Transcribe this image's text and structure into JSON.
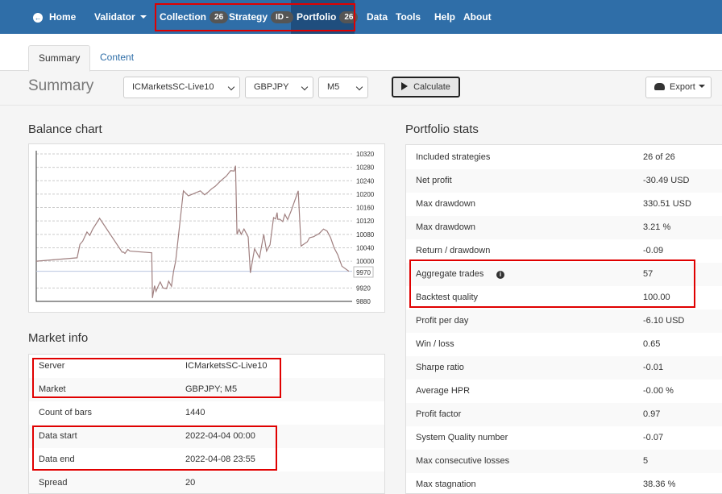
{
  "navbar": {
    "home": "Home",
    "validator": "Validator",
    "collection": "Collection",
    "collection_badge": "26",
    "strategy": "Strategy",
    "strategy_badge": "ID -",
    "portfolio": "Portfolio",
    "portfolio_badge": "26",
    "data": "Data",
    "tools": "Tools",
    "help": "Help",
    "about": "About"
  },
  "tabs": {
    "summary": "Summary",
    "content": "Content"
  },
  "toolbar": {
    "title": "Summary",
    "server": "ICMarketsSC-Live10",
    "symbol": "GBPJPY",
    "period": "M5",
    "calculate": "Calculate",
    "export": "Export"
  },
  "balance_chart": {
    "heading": "Balance chart",
    "current_value_label": "9970",
    "reference_line_value": 9970
  },
  "chart_data": {
    "type": "line",
    "title": "Balance chart",
    "xlabel": "",
    "ylabel": "",
    "ylim": [
      9880,
      10320
    ],
    "y_ticks": [
      9880,
      9920,
      10000,
      10040,
      10080,
      10120,
      10160,
      10200,
      10240,
      10280,
      10320
    ],
    "grid": true,
    "series": [
      {
        "x": [
          0,
          58,
          62,
          66,
          72,
          76,
          80,
          90,
          122,
          124,
          126,
          130,
          133,
          164,
          165,
          168,
          170,
          172,
          174,
          176,
          180,
          185,
          188,
          192,
          195,
          198,
          209,
          216,
          233,
          239,
          244,
          249,
          254,
          262,
          270,
          276,
          281,
          283,
          285,
          288,
          291,
          295,
          301,
          304,
          310,
          317,
          323,
          327,
          332,
          337,
          340,
          342,
          343,
          346,
          350,
          353,
          357,
          362,
          372,
          376,
          385,
          388,
          394,
          402,
          408,
          413,
          418,
          423,
          428,
          434,
          444
        ],
        "y": [
          10000,
          10010,
          10050,
          10060,
          10087,
          10077,
          10095,
          10128,
          10027,
          10027,
          10023,
          10035,
          10030,
          10025,
          9890,
          9927,
          9910,
          9920,
          9930,
          9938,
          9920,
          9918,
          9940,
          9925,
          9970,
          10000,
          10210,
          10195,
          10210,
          10198,
          10206,
          10216,
          10223,
          10240,
          10254,
          10270,
          10269,
          10285,
          10080,
          10095,
          10080,
          10096,
          10072,
          9965,
          10037,
          10010,
          10080,
          10030,
          10049,
          10130,
          10126,
          10145,
          10125,
          10125,
          10118,
          10140,
          10124,
          10150,
          10210,
          10045,
          10058,
          10070,
          10073,
          10083,
          10096,
          10090,
          10070,
          10040,
          10020,
          9985,
          9970
        ]
      }
    ]
  },
  "market_info": {
    "heading": "Market info",
    "rows": [
      {
        "key": "Server",
        "value": "ICMarketsSC-Live10"
      },
      {
        "key": "Market",
        "value": "GBPJPY; M5"
      },
      {
        "key": "Count of bars",
        "value": "1440"
      },
      {
        "key": "Data start",
        "value": "2022-04-04 00:00"
      },
      {
        "key": "Data end",
        "value": "2022-04-08 23:55"
      },
      {
        "key": "Spread",
        "value": "20"
      }
    ]
  },
  "portfolio_stats": {
    "heading": "Portfolio stats",
    "rows": [
      {
        "key": "Included strategies",
        "value": "26 of 26"
      },
      {
        "key": "Net profit",
        "value": "-30.49 USD"
      },
      {
        "key": "Max drawdown",
        "value": "330.51 USD"
      },
      {
        "key": "Max drawdown",
        "value": "3.21 %"
      },
      {
        "key": "Return / drawdown",
        "value": "-0.09"
      },
      {
        "key": "Aggregate trades",
        "value": "57"
      },
      {
        "key": "Backtest quality",
        "value": "100.00"
      },
      {
        "key": "Profit per day",
        "value": "-6.10 USD"
      },
      {
        "key": "Win / loss",
        "value": "0.65"
      },
      {
        "key": "Sharpe ratio",
        "value": "-0.01"
      },
      {
        "key": "Average HPR",
        "value": "-0.00 %"
      },
      {
        "key": "Profit factor",
        "value": "0.97"
      },
      {
        "key": "System Quality number",
        "value": "-0.07"
      },
      {
        "key": "Max consecutive losses",
        "value": "5"
      },
      {
        "key": "Max stagnation",
        "value": "38.36 %"
      }
    ]
  },
  "colors": {
    "navbar": "#2f6ea8",
    "navbar_active": "#1f4e7e",
    "highlight_box": "#e00000",
    "line": "#a08080"
  },
  "icons": {
    "home": "home-icon",
    "info": "info-icon",
    "export": "cloud-download-icon",
    "calculate": "play-icon"
  }
}
